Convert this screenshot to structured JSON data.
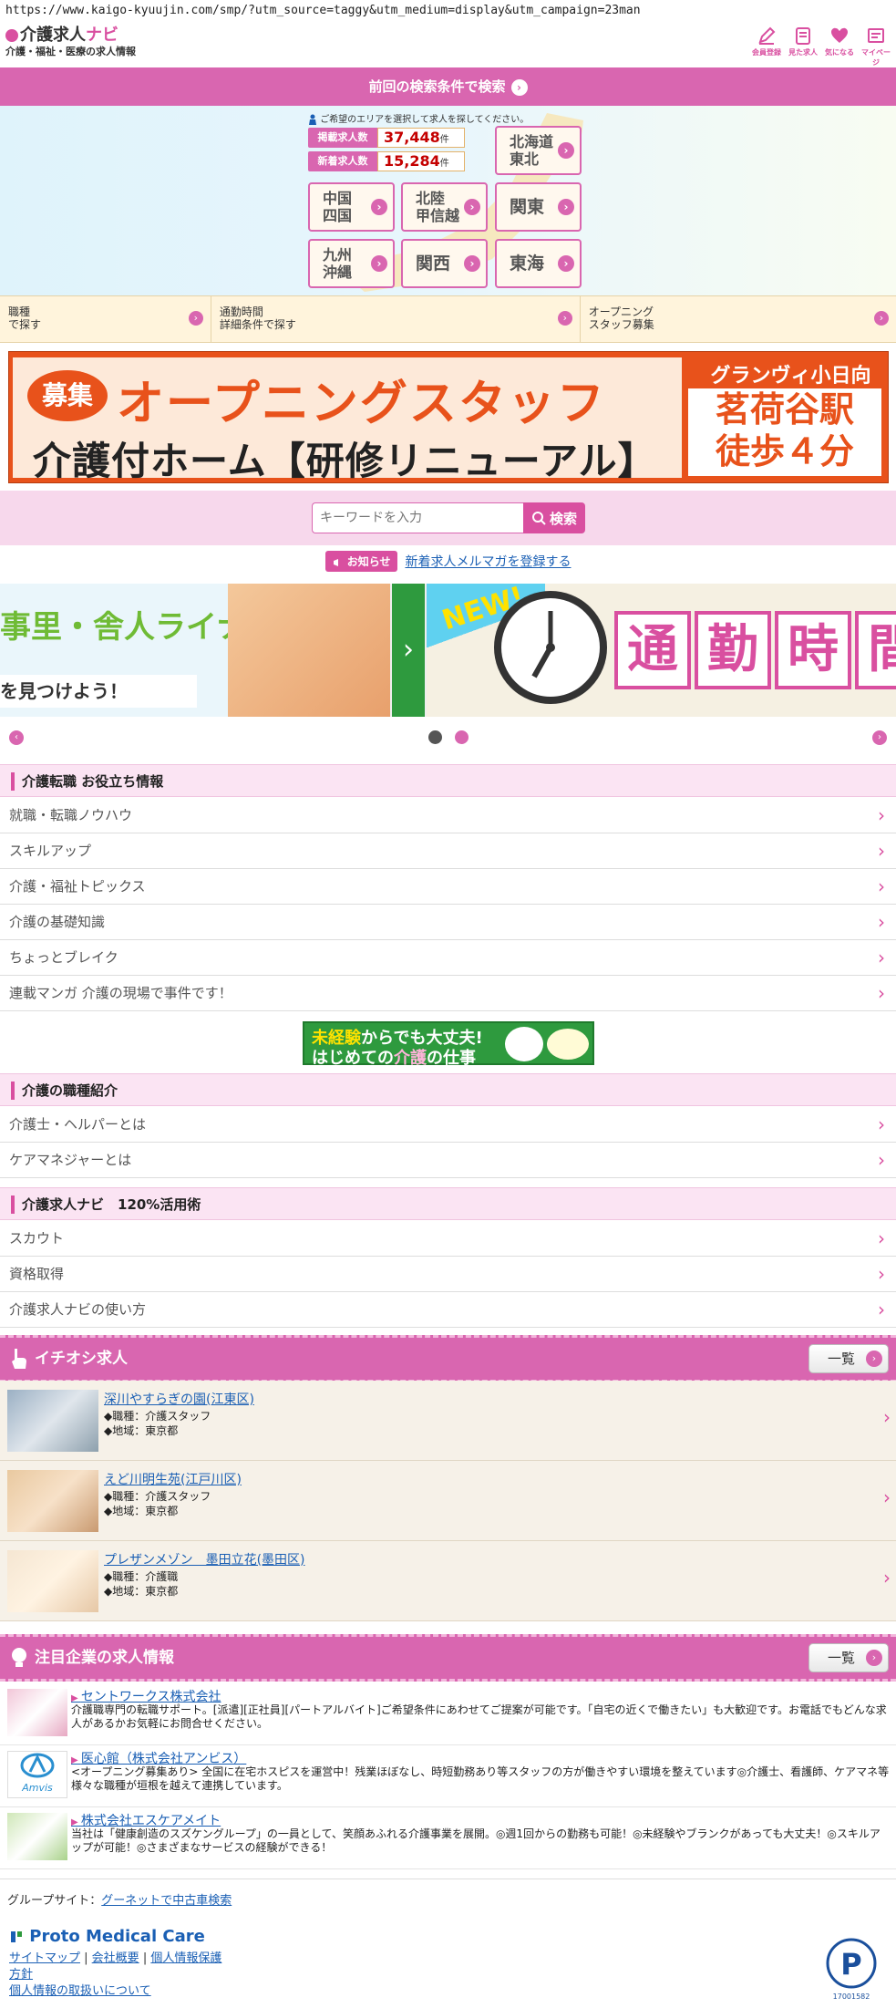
{
  "url": "https://www.kaigo-kyuujin.com/smp/?utm_source=taggy&utm_medium=display&utm_campaign=23man",
  "header": {
    "logo_main": "介護求人",
    "logo_kana": "ナビ",
    "logo_sub": "介護・福祉・医療の求人情報",
    "icons": [
      {
        "label": "会員登録",
        "icon": "pencil-icon"
      },
      {
        "label": "見た求人",
        "icon": "history-icon"
      },
      {
        "label": "気になる",
        "icon": "heart-icon"
      },
      {
        "label": "マイページ",
        "icon": "mypage-icon"
      }
    ]
  },
  "prev_search": {
    "label": "前回の検索条件で検索"
  },
  "map": {
    "hint": "ご希望のエリアを選択して求人を探してください。",
    "posted_label": "掲載求人数",
    "posted_value": "37,448",
    "new_label": "新着求人数",
    "new_value": "15,284",
    "unit": "件",
    "regions": {
      "hokkaido_l1": "北海道",
      "hokkaido_l2": "東北",
      "chugoku_l1": "中国",
      "chugoku_l2": "四国",
      "hokuriku_l1": "北陸",
      "hokuriku_l2": "甲信越",
      "kanto": "関東",
      "kyushu_l1": "九州",
      "kyushu_l2": "沖縄",
      "kansai": "関西",
      "tokai": "東海"
    }
  },
  "tri": [
    {
      "l1": "職種",
      "l2": "で探す"
    },
    {
      "l1": "通勤時間",
      "l2": "詳細条件で探す"
    },
    {
      "l1": "オープニング",
      "l2": "スタッフ募集"
    }
  ],
  "banner": {
    "badge": "募集",
    "main": "オープニングスタッフ",
    "sub": "介護付ホーム【研修リニューアル】",
    "facility": "グランヴィ小日向",
    "station": "茗荷谷駅",
    "walk": "徒歩４分"
  },
  "search": {
    "placeholder": "キーワードを入力",
    "button": "検索"
  },
  "notice": {
    "badge": "お知らせ",
    "link": "新着求人メルマガを登録する"
  },
  "slider": {
    "s1_text1": "事里・舎人ライナー",
    "s1_text2": "を見つけよう！",
    "s2_new": "NEW!",
    "s2_chars": [
      "通",
      "勤",
      "時",
      "間"
    ]
  },
  "sections": {
    "tips": {
      "title": "介護転職 お役立ち情報",
      "items": [
        "就職・転職ノウハウ",
        "スキルアップ",
        "介護・福祉トピックス",
        "介護の基礎知識",
        "ちょっとブレイク",
        "連載マンガ 介護の現場で事件です！"
      ]
    },
    "mikeiken": {
      "line1_a": "未経験",
      "line1_b": "からでも大丈夫!",
      "line2_a": "はじめての",
      "line2_b": "介護",
      "line2_c": "の仕事"
    },
    "jobtypes": {
      "title": "介護の職種紹介",
      "items": [
        "介護士・ヘルパーとは",
        "ケアマネジャーとは"
      ]
    },
    "usage": {
      "title": "介護求人ナビ　120%活用術",
      "items": [
        "スカウト",
        "資格取得",
        "介護求人ナビの使い方"
      ]
    }
  },
  "featured": {
    "title": "イチオシ求人",
    "more": "一覧",
    "jobs": [
      {
        "name": "深川やすらぎの園(江東区)",
        "role": "◆職種：介護スタッフ",
        "area": "◆地域：東京都"
      },
      {
        "name": "えど川明生苑(江戸川区)",
        "role": "◆職種：介護スタッフ",
        "area": "◆地域：東京都"
      },
      {
        "name": "プレザンメゾン　墨田立花(墨田区)",
        "role": "◆職種：介護職",
        "area": "◆地域：東京都"
      }
    ]
  },
  "companies": {
    "title": "注目企業の求人情報",
    "more": "一覧",
    "items": [
      {
        "name": "セントワークス株式会社",
        "desc": "介護職専門の転職サポート。[派遣][正社員][パートアルバイト]ご希望条件にあわせてご提案が可能です。「自宅の近くで働きたい」も大歓迎です。お電話でもどんな求人があるかお気軽にお問合せください。"
      },
      {
        "name": "医心館（株式会社アンビス）",
        "logo": "Amvis",
        "desc": "<オープニング募集あり> 全国に在宅ホスピスを運営中！残業ほぼなし、時短勤務あり等スタッフの方が働きやすい環境を整えています◎介護士、看護師、ケアマネ等様々な職種が垣根を越えて連携しています。"
      },
      {
        "name": "株式会社エスケアメイト",
        "desc": "当社は「健康創造のスズケングループ」の一員として、笑顔あふれる介護事業を展開。◎週1回からの勤務も可能！◎未経験やブランクがあっても大丈夫！◎スキルアップが可能！◎さまざまなサービスの経験ができる！"
      }
    ]
  },
  "footer": {
    "group_label": "グループサイト：",
    "group_link": "グーネットで中古車検索",
    "brand": "Proto Medical Care",
    "links": [
      "サイトマップ",
      "会社概要",
      "個人情報保護",
      "方針",
      "個人情報の取扱いについて"
    ],
    "pmark_no": "17001582"
  },
  "colors": {
    "accent": "#d966b0",
    "accent_dark": "#d94fa0",
    "banner_orange": "#e8521b",
    "link": "#1a5fb4"
  }
}
